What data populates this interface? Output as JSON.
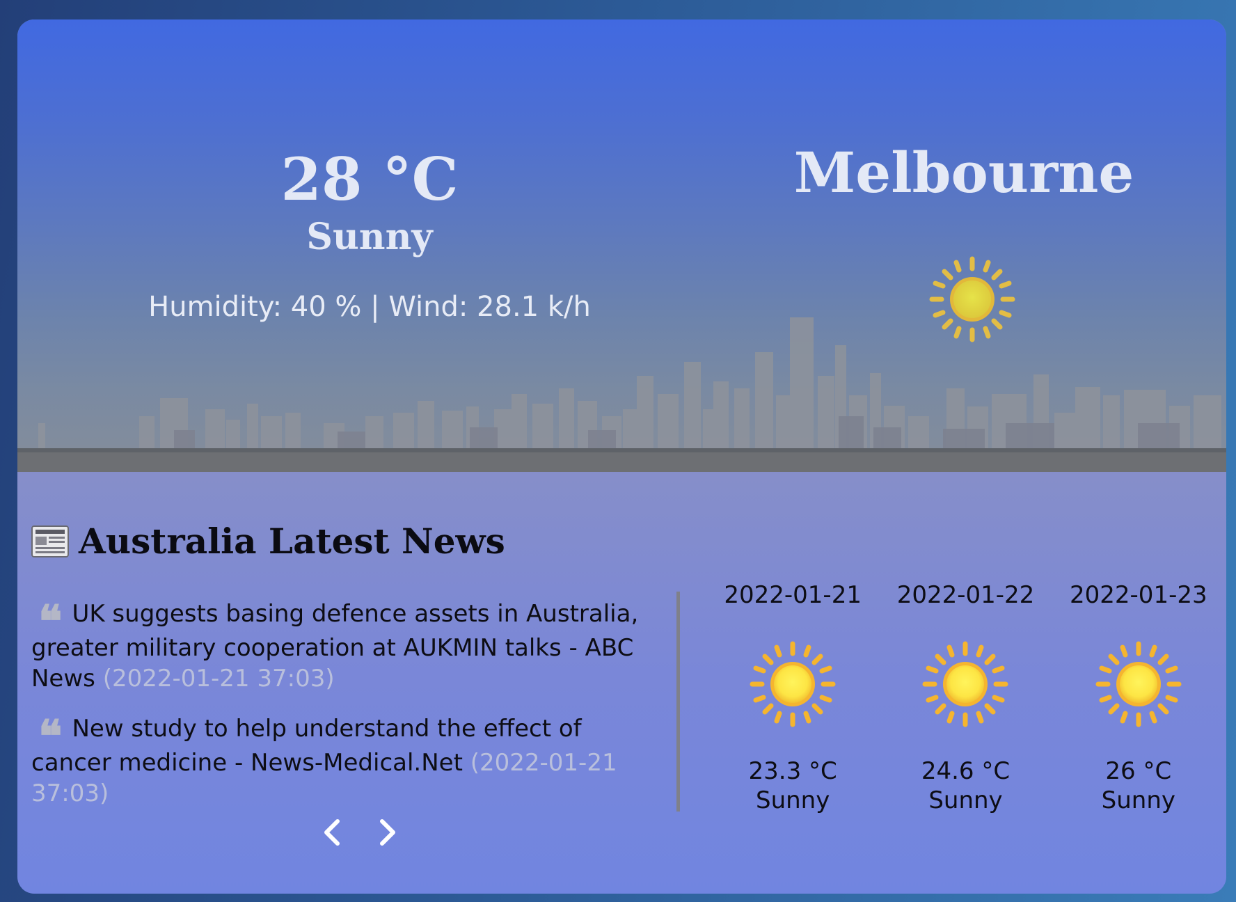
{
  "current": {
    "temperature": "28 °C",
    "condition": "Sunny",
    "details": "Humidity: 40 % | Wind: 28.1 k/h",
    "city": "Melbourne",
    "icon": "sun-icon"
  },
  "news": {
    "title": "Australia Latest News",
    "icon": "newspaper-icon",
    "items": [
      {
        "headline": "UK suggests basing defence assets in Australia, greater military cooperation at AUKMIN talks - ABC News",
        "date": "(2022-01-21 37:03)"
      },
      {
        "headline": "New study to help understand the effect of cancer medicine - News-Medical.Net",
        "date": "(2022-01-21 37:03)"
      }
    ],
    "prev_icon": "chevron-left-icon",
    "next_icon": "chevron-right-icon"
  },
  "forecast": [
    {
      "date": "2022-01-21",
      "temp": "23.3 °C",
      "condition": "Sunny",
      "icon": "sun-icon"
    },
    {
      "date": "2022-01-22",
      "temp": "24.6 °C",
      "condition": "Sunny",
      "icon": "sun-icon"
    },
    {
      "date": "2022-01-23",
      "temp": "26 °C",
      "condition": "Sunny",
      "icon": "sun-icon"
    }
  ],
  "colors": {
    "hero_top": "#4169e1",
    "card_bottom": "#7185e0",
    "text_light": "#e4e9f6",
    "news_date": "#b9bfdc",
    "sun_core": "#fde544",
    "sun_rays": "#f5b52f"
  }
}
